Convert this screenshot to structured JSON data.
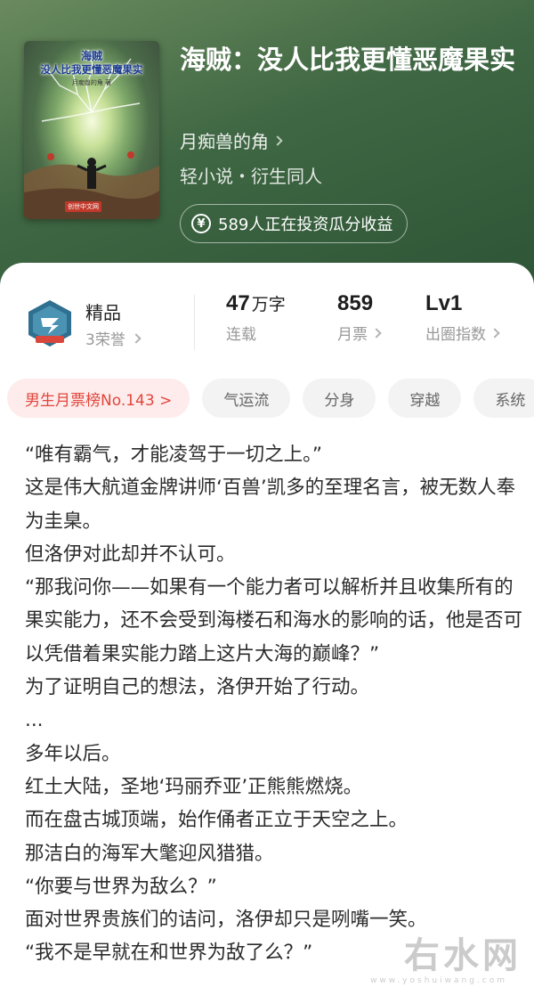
{
  "book": {
    "cover": {
      "title_line1": "海贼",
      "title_line2": "没人比我更懂恶魔果实",
      "author_small": "月痴兽的角 著",
      "badge": "创世中文网"
    },
    "title": "海贼：没人比我更懂恶魔果实",
    "author": "月痴兽的角",
    "genre": "轻小说・衍生同人",
    "invest_text": "589人正在投资瓜分收益"
  },
  "stats": {
    "honor_title": "精品",
    "honor_sub": "3荣誉",
    "words_value": "47",
    "words_unit": "万字",
    "words_label": "连载",
    "ticket_value": "859",
    "ticket_label": "月票",
    "level_value": "Lv1",
    "level_label": "出圈指数"
  },
  "tags": [
    {
      "label": "男生月票榜No.143 >",
      "type": "rank"
    },
    {
      "label": "气运流",
      "type": "normal"
    },
    {
      "label": "分身",
      "type": "normal"
    },
    {
      "label": "穿越",
      "type": "normal"
    },
    {
      "label": "系统",
      "type": "normal"
    }
  ],
  "intro": [
    "“唯有霸气，才能凌驾于一切之上。”",
    "这是伟大航道金牌讲师‘百兽’凯多的至理名言，被无数人奉为圭臬。",
    "但洛伊对此却并不认可。",
    "“那我问你——如果有一个能力者可以解析并且收集所有的果实能力，还不会受到海楼石和海水的影响的话，他是否可以凭借着果实能力踏上这片大海的巅峰？”",
    "为了证明自己的想法，洛伊开始了行动。",
    "...",
    "多年以后。",
    "红土大陆，圣地‘玛丽乔亚’正熊熊燃烧。",
    "而在盘古城顶端，始作俑者正立于天空之上。",
    "那洁白的海军大氅迎风猎猎。",
    "“你要与世界为敌么？”",
    "面对世界贵族们的诘问，洛伊却只是咧嘴一笑。",
    "“我不是早就在和世界为敌了么？”"
  ],
  "watermark": {
    "text": "右水网",
    "sub": "www.yoshuiwang.com"
  },
  "colors": {
    "header_bg": "#3f6743",
    "rank_tag_text": "#e2463d",
    "rank_tag_bg": "#fdeceb",
    "tag_bg": "#f3f3f3"
  }
}
